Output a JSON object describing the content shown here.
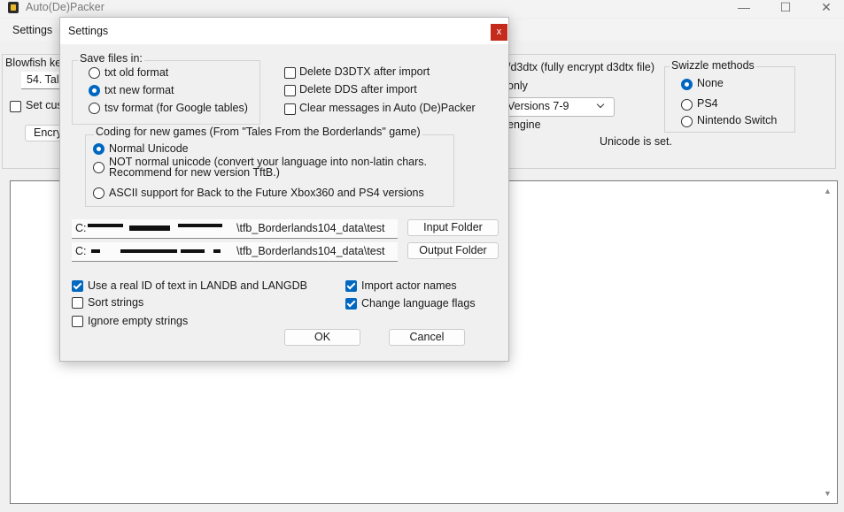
{
  "app": {
    "title": "Auto(De)Packer",
    "minimize": "—",
    "maximize": "☐",
    "close": "✕",
    "menu_settings": "Settings"
  },
  "background": {
    "blowfish_label": "Blowfish ke",
    "blowfish_value": "54. Tal",
    "set_custom_label": "Set cus",
    "encrypt_button": "Encry",
    "d3dtx_label": "/d3dtx (fully encrypt d3dtx file)",
    "only_label": "only",
    "versions_value": "Versions 7-9",
    "engine_label": "engine",
    "unicode_status": "Unicode is set.",
    "swizzle": {
      "legend": "Swizzle methods",
      "options": [
        "None",
        "PS4",
        "Nintendo Switch"
      ],
      "selected": 0
    }
  },
  "dialog": {
    "title": "Settings",
    "close_label": "x",
    "save_files": {
      "legend": "Save files in:",
      "options": [
        "txt old format",
        "txt new format",
        "tsv format (for Google tables)"
      ],
      "selected": 1
    },
    "checks_right": [
      {
        "label": "Delete D3DTX after import",
        "checked": false
      },
      {
        "label": "Delete DDS after import",
        "checked": false
      },
      {
        "label": "Clear messages in Auto (De)Packer",
        "checked": false
      }
    ],
    "coding": {
      "legend": "Coding for new games (From \"Tales From the Borderlands\" game)",
      "opt1": "Normal Unicode",
      "opt2_line1": "NOT normal unicode (convert your language into non-latin chars.",
      "opt2_line2": "Recommend for new version TftB.)",
      "opt3": "ASCII support for Back to the Future Xbox360 and PS4 versions",
      "selected": 0
    },
    "input_path": {
      "prefix": "C:",
      "suffix": "\\tfb_Borderlands104_data\\test"
    },
    "output_path": {
      "prefix": "C:",
      "suffix": "\\tfb_Borderlands104_data\\test"
    },
    "input_button": "Input Folder",
    "output_button": "Output Folder",
    "checks_bottom_left": [
      {
        "label": "Use a real ID of text in LANDB and LANGDB",
        "checked": true
      },
      {
        "label": "Sort strings",
        "checked": false
      },
      {
        "label": "Ignore empty strings",
        "checked": false
      }
    ],
    "checks_bottom_right": [
      {
        "label": "Import actor names",
        "checked": true
      },
      {
        "label": "Change language flags",
        "checked": true
      }
    ],
    "ok_button": "OK",
    "cancel_button": "Cancel"
  },
  "colors": {
    "accent": "#0067c0",
    "close_red": "#c42b1c"
  }
}
